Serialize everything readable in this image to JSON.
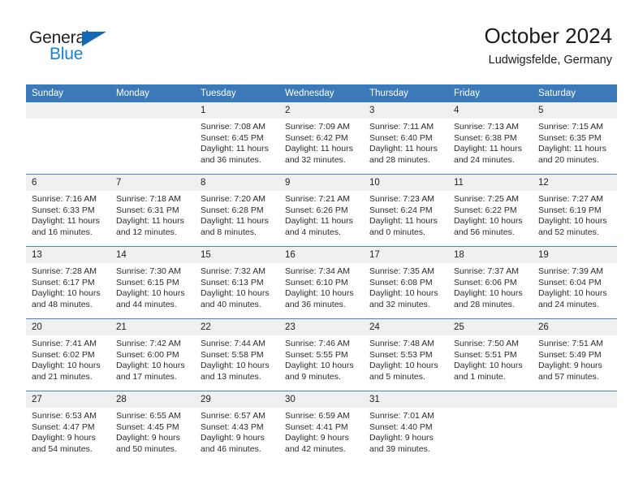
{
  "brand": {
    "name_top": "General",
    "name_bottom": "Blue",
    "accent_color": "#1268b3",
    "blue_text_color": "#1b7fd4"
  },
  "header": {
    "title": "October 2024",
    "subtitle": "Ludwigsfelde, Germany",
    "header_bg": "#3b79b8",
    "header_text": "#ffffff",
    "date_band_bg": "#f0f0f0",
    "row_divider": "#4a86c0"
  },
  "weekdays": [
    "Sunday",
    "Monday",
    "Tuesday",
    "Wednesday",
    "Thursday",
    "Friday",
    "Saturday"
  ],
  "labels": {
    "sunrise_prefix": "Sunrise:",
    "sunset_prefix": "Sunset:",
    "daylight_prefix": "Daylight:"
  },
  "weeks": [
    [
      {
        "blank": true
      },
      {
        "blank": true
      },
      {
        "day": "1",
        "sunrise": "Sunrise: 7:08 AM",
        "sunset": "Sunset: 6:45 PM",
        "daylight": "Daylight: 11 hours and 36 minutes."
      },
      {
        "day": "2",
        "sunrise": "Sunrise: 7:09 AM",
        "sunset": "Sunset: 6:42 PM",
        "daylight": "Daylight: 11 hours and 32 minutes."
      },
      {
        "day": "3",
        "sunrise": "Sunrise: 7:11 AM",
        "sunset": "Sunset: 6:40 PM",
        "daylight": "Daylight: 11 hours and 28 minutes."
      },
      {
        "day": "4",
        "sunrise": "Sunrise: 7:13 AM",
        "sunset": "Sunset: 6:38 PM",
        "daylight": "Daylight: 11 hours and 24 minutes."
      },
      {
        "day": "5",
        "sunrise": "Sunrise: 7:15 AM",
        "sunset": "Sunset: 6:35 PM",
        "daylight": "Daylight: 11 hours and 20 minutes."
      }
    ],
    [
      {
        "day": "6",
        "sunrise": "Sunrise: 7:16 AM",
        "sunset": "Sunset: 6:33 PM",
        "daylight": "Daylight: 11 hours and 16 minutes."
      },
      {
        "day": "7",
        "sunrise": "Sunrise: 7:18 AM",
        "sunset": "Sunset: 6:31 PM",
        "daylight": "Daylight: 11 hours and 12 minutes."
      },
      {
        "day": "8",
        "sunrise": "Sunrise: 7:20 AM",
        "sunset": "Sunset: 6:28 PM",
        "daylight": "Daylight: 11 hours and 8 minutes."
      },
      {
        "day": "9",
        "sunrise": "Sunrise: 7:21 AM",
        "sunset": "Sunset: 6:26 PM",
        "daylight": "Daylight: 11 hours and 4 minutes."
      },
      {
        "day": "10",
        "sunrise": "Sunrise: 7:23 AM",
        "sunset": "Sunset: 6:24 PM",
        "daylight": "Daylight: 11 hours and 0 minutes."
      },
      {
        "day": "11",
        "sunrise": "Sunrise: 7:25 AM",
        "sunset": "Sunset: 6:22 PM",
        "daylight": "Daylight: 10 hours and 56 minutes."
      },
      {
        "day": "12",
        "sunrise": "Sunrise: 7:27 AM",
        "sunset": "Sunset: 6:19 PM",
        "daylight": "Daylight: 10 hours and 52 minutes."
      }
    ],
    [
      {
        "day": "13",
        "sunrise": "Sunrise: 7:28 AM",
        "sunset": "Sunset: 6:17 PM",
        "daylight": "Daylight: 10 hours and 48 minutes."
      },
      {
        "day": "14",
        "sunrise": "Sunrise: 7:30 AM",
        "sunset": "Sunset: 6:15 PM",
        "daylight": "Daylight: 10 hours and 44 minutes."
      },
      {
        "day": "15",
        "sunrise": "Sunrise: 7:32 AM",
        "sunset": "Sunset: 6:13 PM",
        "daylight": "Daylight: 10 hours and 40 minutes."
      },
      {
        "day": "16",
        "sunrise": "Sunrise: 7:34 AM",
        "sunset": "Sunset: 6:10 PM",
        "daylight": "Daylight: 10 hours and 36 minutes."
      },
      {
        "day": "17",
        "sunrise": "Sunrise: 7:35 AM",
        "sunset": "Sunset: 6:08 PM",
        "daylight": "Daylight: 10 hours and 32 minutes."
      },
      {
        "day": "18",
        "sunrise": "Sunrise: 7:37 AM",
        "sunset": "Sunset: 6:06 PM",
        "daylight": "Daylight: 10 hours and 28 minutes."
      },
      {
        "day": "19",
        "sunrise": "Sunrise: 7:39 AM",
        "sunset": "Sunset: 6:04 PM",
        "daylight": "Daylight: 10 hours and 24 minutes."
      }
    ],
    [
      {
        "day": "20",
        "sunrise": "Sunrise: 7:41 AM",
        "sunset": "Sunset: 6:02 PM",
        "daylight": "Daylight: 10 hours and 21 minutes."
      },
      {
        "day": "21",
        "sunrise": "Sunrise: 7:42 AM",
        "sunset": "Sunset: 6:00 PM",
        "daylight": "Daylight: 10 hours and 17 minutes."
      },
      {
        "day": "22",
        "sunrise": "Sunrise: 7:44 AM",
        "sunset": "Sunset: 5:58 PM",
        "daylight": "Daylight: 10 hours and 13 minutes."
      },
      {
        "day": "23",
        "sunrise": "Sunrise: 7:46 AM",
        "sunset": "Sunset: 5:55 PM",
        "daylight": "Daylight: 10 hours and 9 minutes."
      },
      {
        "day": "24",
        "sunrise": "Sunrise: 7:48 AM",
        "sunset": "Sunset: 5:53 PM",
        "daylight": "Daylight: 10 hours and 5 minutes."
      },
      {
        "day": "25",
        "sunrise": "Sunrise: 7:50 AM",
        "sunset": "Sunset: 5:51 PM",
        "daylight": "Daylight: 10 hours and 1 minute."
      },
      {
        "day": "26",
        "sunrise": "Sunrise: 7:51 AM",
        "sunset": "Sunset: 5:49 PM",
        "daylight": "Daylight: 9 hours and 57 minutes."
      }
    ],
    [
      {
        "day": "27",
        "sunrise": "Sunrise: 6:53 AM",
        "sunset": "Sunset: 4:47 PM",
        "daylight": "Daylight: 9 hours and 54 minutes."
      },
      {
        "day": "28",
        "sunrise": "Sunrise: 6:55 AM",
        "sunset": "Sunset: 4:45 PM",
        "daylight": "Daylight: 9 hours and 50 minutes."
      },
      {
        "day": "29",
        "sunrise": "Sunrise: 6:57 AM",
        "sunset": "Sunset: 4:43 PM",
        "daylight": "Daylight: 9 hours and 46 minutes."
      },
      {
        "day": "30",
        "sunrise": "Sunrise: 6:59 AM",
        "sunset": "Sunset: 4:41 PM",
        "daylight": "Daylight: 9 hours and 42 minutes."
      },
      {
        "day": "31",
        "sunrise": "Sunrise: 7:01 AM",
        "sunset": "Sunset: 4:40 PM",
        "daylight": "Daylight: 9 hours and 39 minutes."
      },
      {
        "blank": true
      },
      {
        "blank": true
      }
    ]
  ]
}
